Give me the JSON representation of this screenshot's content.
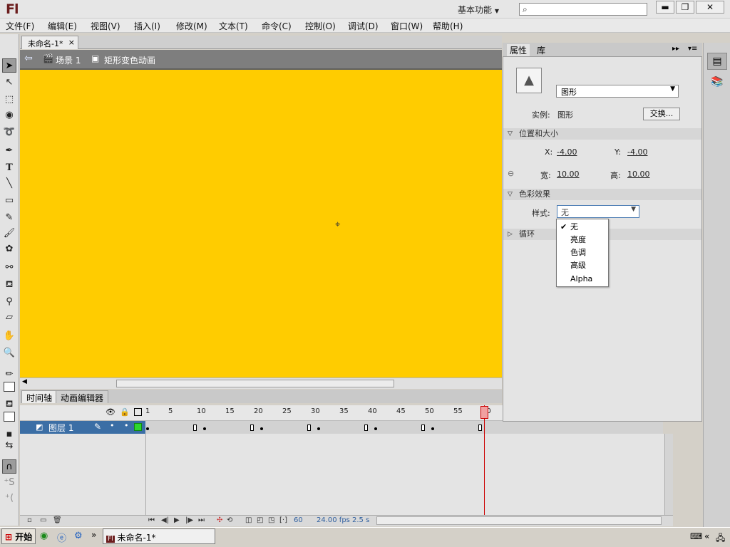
{
  "titlebar": {
    "logo": "Fl",
    "workspace": "基本功能",
    "search_placeholder": "",
    "min": "▬",
    "max": "❐",
    "close": "✕"
  },
  "menu": [
    "文件(F)",
    "编辑(E)",
    "视图(V)",
    "插入(I)",
    "修改(M)",
    "文本(T)",
    "命令(C)",
    "控制(O)",
    "调试(D)",
    "窗口(W)",
    "帮助(H)"
  ],
  "document": {
    "tab": "未命名-1*",
    "tab_close": "×",
    "scene": "场景 1",
    "symbol": "矩形变色动画"
  },
  "timeline": {
    "tabs": [
      "时间轴",
      "动画编辑器"
    ],
    "ruler": [
      "1",
      "5",
      "10",
      "15",
      "20",
      "25",
      "30",
      "35",
      "40",
      "45",
      "50",
      "55",
      "60"
    ],
    "layer": "图层 1",
    "current_frame": "60",
    "fps": "24.00 fps",
    "elapsed": "2.5 s"
  },
  "properties": {
    "tabs": [
      "属性",
      "库"
    ],
    "symbol_type": "图形",
    "instance_label": "实例:",
    "instance_value": "图形",
    "swap": "交换...",
    "pos_section": "位置和大小",
    "x_label": "X:",
    "x_value": "-4.00",
    "y_label": "Y:",
    "y_value": "-4.00",
    "w_label": "宽:",
    "w_value": "10.00",
    "h_label": "高:",
    "h_value": "10.00",
    "color_section": "色彩效果",
    "style_label": "样式:",
    "style_value": "无",
    "loop_section": "循环",
    "style_options": [
      "无",
      "亮度",
      "色调",
      "高级",
      "Alpha"
    ],
    "style_selected": "无"
  },
  "taskbar": {
    "start": "开始",
    "task": "未命名-1*"
  },
  "colors": {
    "stage": "#ffcc00",
    "layer_selected": "#3b6ea5",
    "playhead": "#cc0000"
  }
}
